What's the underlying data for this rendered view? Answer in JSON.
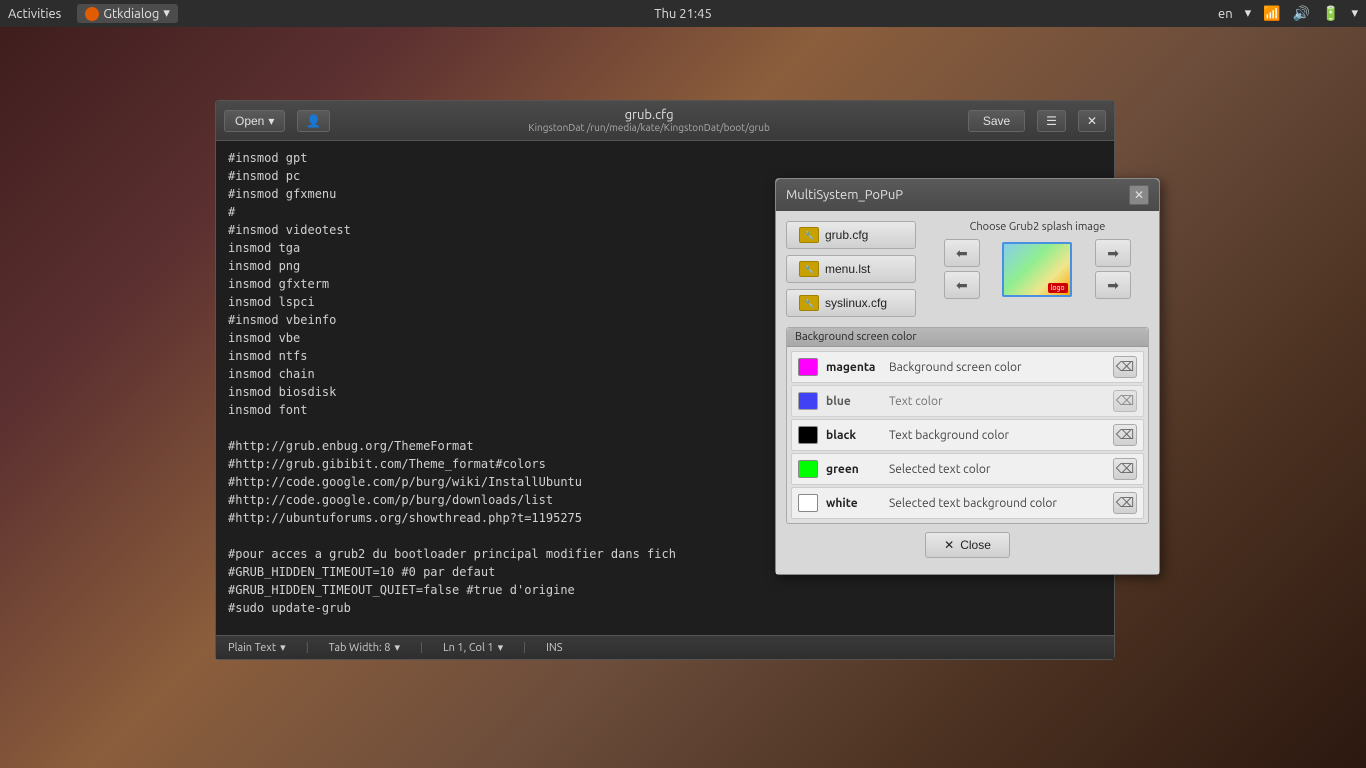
{
  "topbar": {
    "activities": "Activities",
    "app_name": "Gtkdialog",
    "app_arrow": "▾",
    "time": "Thu 21:45",
    "lang": "en",
    "lang_arrow": "▾"
  },
  "editor": {
    "title": "grub.cfg",
    "subtitle": "KingstonDat /run/media/kate/KingstonDat/boot/grub",
    "open_label": "Open",
    "save_label": "Save",
    "content": "#insmod gpt\n#insmod pc\n#insmod gfxmenu\n#\n#insmod videotest\ninsmod tga\ninsmod png\ninsmod gfxterm\ninsmod lspci\n#insmod vbeinfo\ninsmod vbe\ninsmod ntfs\ninsmod chain\ninsmod biosdisk\ninsmod font\n\n#http://grub.enbug.org/ThemeFormat\n#http://grub.gibibit.com/Theme_format#colors\n#http://code.google.com/p/burg/wiki/InstallUbuntu\n#http://code.google.com/p/burg/downloads/list\n#http://ubuntuforums.org/showthread.php?t=1195275\n\n#pour acces a grub2 du bootloader principal modifier dans fich\n#GRUB_HIDDEN_TIMEOUT=10 #0 par defaut\n#GRUB_HIDDEN_TIMEOUT_QUIET=false #true d'origine\n#sudo update-grub",
    "status": {
      "plain_text": "Plain Text",
      "tab_width": "Tab Width: 8",
      "position": "Ln 1, Col 1",
      "ins": "INS"
    }
  },
  "popup": {
    "title": "MultiSystem_PoPuP",
    "splash_section_title": "Choose Grub2 splash image",
    "buttons": [
      {
        "label": "grub.cfg"
      },
      {
        "label": "menu.lst"
      },
      {
        "label": "syslinux.cfg"
      }
    ],
    "bg_section_title": "Background screen color",
    "color_rows": [
      {
        "color": "#ff00ff",
        "name": "magenta",
        "desc": "Background screen color"
      },
      {
        "color": "#0000ff",
        "name": "blue",
        "desc": "Text color"
      },
      {
        "color": "#000000",
        "name": "black",
        "desc": "Text background color"
      },
      {
        "color": "#00ff00",
        "name": "green",
        "desc": "Selected text color"
      },
      {
        "color": "#ffffff",
        "name": "white",
        "desc": "Selected text background color"
      }
    ],
    "close_label": "Close"
  }
}
